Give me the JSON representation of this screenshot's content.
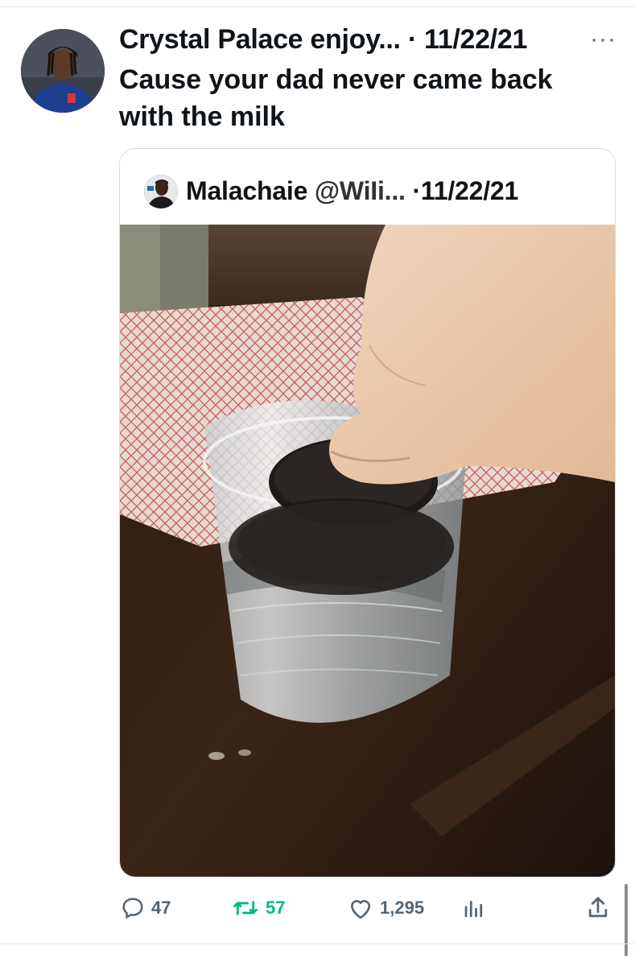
{
  "tweet": {
    "author_name": "Crystal Palace enjoy...",
    "separator": "·",
    "date": "11/22/21",
    "more_label": "···",
    "text_line1": "Cause your dad never came back",
    "text_line2": "with the milk"
  },
  "quote": {
    "author_name": "Malachaie",
    "handle": "@WiIi...",
    "separator": "·",
    "date": "11/22/21",
    "image_alt": "Oreo dunked in a glass of water"
  },
  "actions": {
    "replies": "47",
    "retweets": "57",
    "likes": "1,295"
  },
  "colors": {
    "text": "#0f1419",
    "muted": "#536471",
    "retweet_green": "#00ba7c",
    "border": "#d6dbe0"
  },
  "icons": [
    "reply-icon",
    "retweet-icon",
    "like-icon",
    "views-icon",
    "share-icon",
    "more-icon"
  ]
}
